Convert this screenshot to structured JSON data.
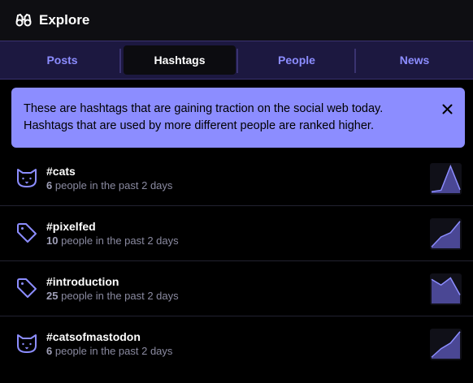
{
  "header": {
    "title": "Explore",
    "icon": "binoculars-icon"
  },
  "tabs": [
    {
      "label": "Posts",
      "active": false
    },
    {
      "label": "Hashtags",
      "active": true
    },
    {
      "label": "People",
      "active": false
    },
    {
      "label": "News",
      "active": false
    }
  ],
  "banner": {
    "text": "These are hashtags that are gaining traction on the social web today. Hashtags that are used by more different people are ranked higher.",
    "close_icon": "close-icon"
  },
  "hashtags": [
    {
      "name": "#cats",
      "count": "6",
      "suffix": "people in the past 2 days",
      "icon": "cat-icon",
      "trend": [
        0.05,
        0.1,
        0.95,
        0.12
      ]
    },
    {
      "name": "#pixelfed",
      "count": "10",
      "suffix": "people in the past 2 days",
      "icon": "tag-icon",
      "trend": [
        0.05,
        0.4,
        0.55,
        0.95
      ]
    },
    {
      "name": "#introduction",
      "count": "25",
      "suffix": "people in the past 2 days",
      "icon": "tag-icon",
      "trend": [
        0.85,
        0.65,
        0.9,
        0.3
      ]
    },
    {
      "name": "#catsofmastodon",
      "count": "6",
      "suffix": "people in the past 2 days",
      "icon": "cat-icon",
      "trend": [
        0.05,
        0.35,
        0.55,
        0.95
      ]
    }
  ],
  "colors": {
    "accent": "#8c8dff",
    "tab_bar": "#1c1840",
    "spark_fill": "#4a4794",
    "spark_line": "#8c8dff"
  }
}
